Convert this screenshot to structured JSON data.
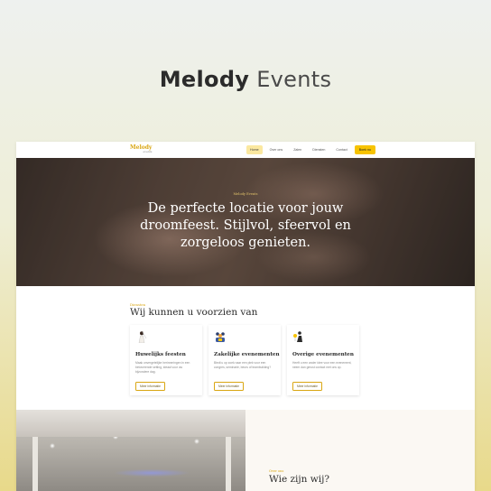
{
  "banner": {
    "brand_bold": "Melody",
    "brand_light": "Events"
  },
  "site": {
    "logo": "Melody",
    "logo_sub": "events",
    "nav": [
      "Home",
      "Over ons",
      "Zalen",
      "Diensten",
      "Contact",
      "Boek nu"
    ],
    "hero": {
      "kicker": "Melody Events",
      "title": "De perfecte locatie voor jouw droomfeest. Stijlvol, sfeervol en zorgeloos genieten."
    },
    "services": {
      "kicker": "Diensten",
      "heading": "Wij kunnen u voorzien van",
      "cards": [
        {
          "icon": "bride-icon",
          "title": "Huwelijks feesten",
          "desc": "Maak onvergetelijke herinneringen in een betoverende setting, ideaal voor uw bijzondere dag.",
          "button": "Meer informatie"
        },
        {
          "icon": "business-group-icon",
          "title": "Zakelijke evenementen",
          "desc": "Biedt u op zoek naar een plek voor een congres, seminarie, beurs of teambuilding?",
          "button": "Meer informatie"
        },
        {
          "icon": "party-icon",
          "title": "Overige evenementen",
          "desc": "Heeft u een ander idee voor een evenement, neem dan gerust contact met ons op.",
          "button": "Meer informatie"
        }
      ]
    },
    "about": {
      "kicker": "Over ons",
      "heading": "Wie zijn wij?"
    }
  },
  "colors": {
    "accent": "#f7c300",
    "accent_text": "#d9a612"
  }
}
